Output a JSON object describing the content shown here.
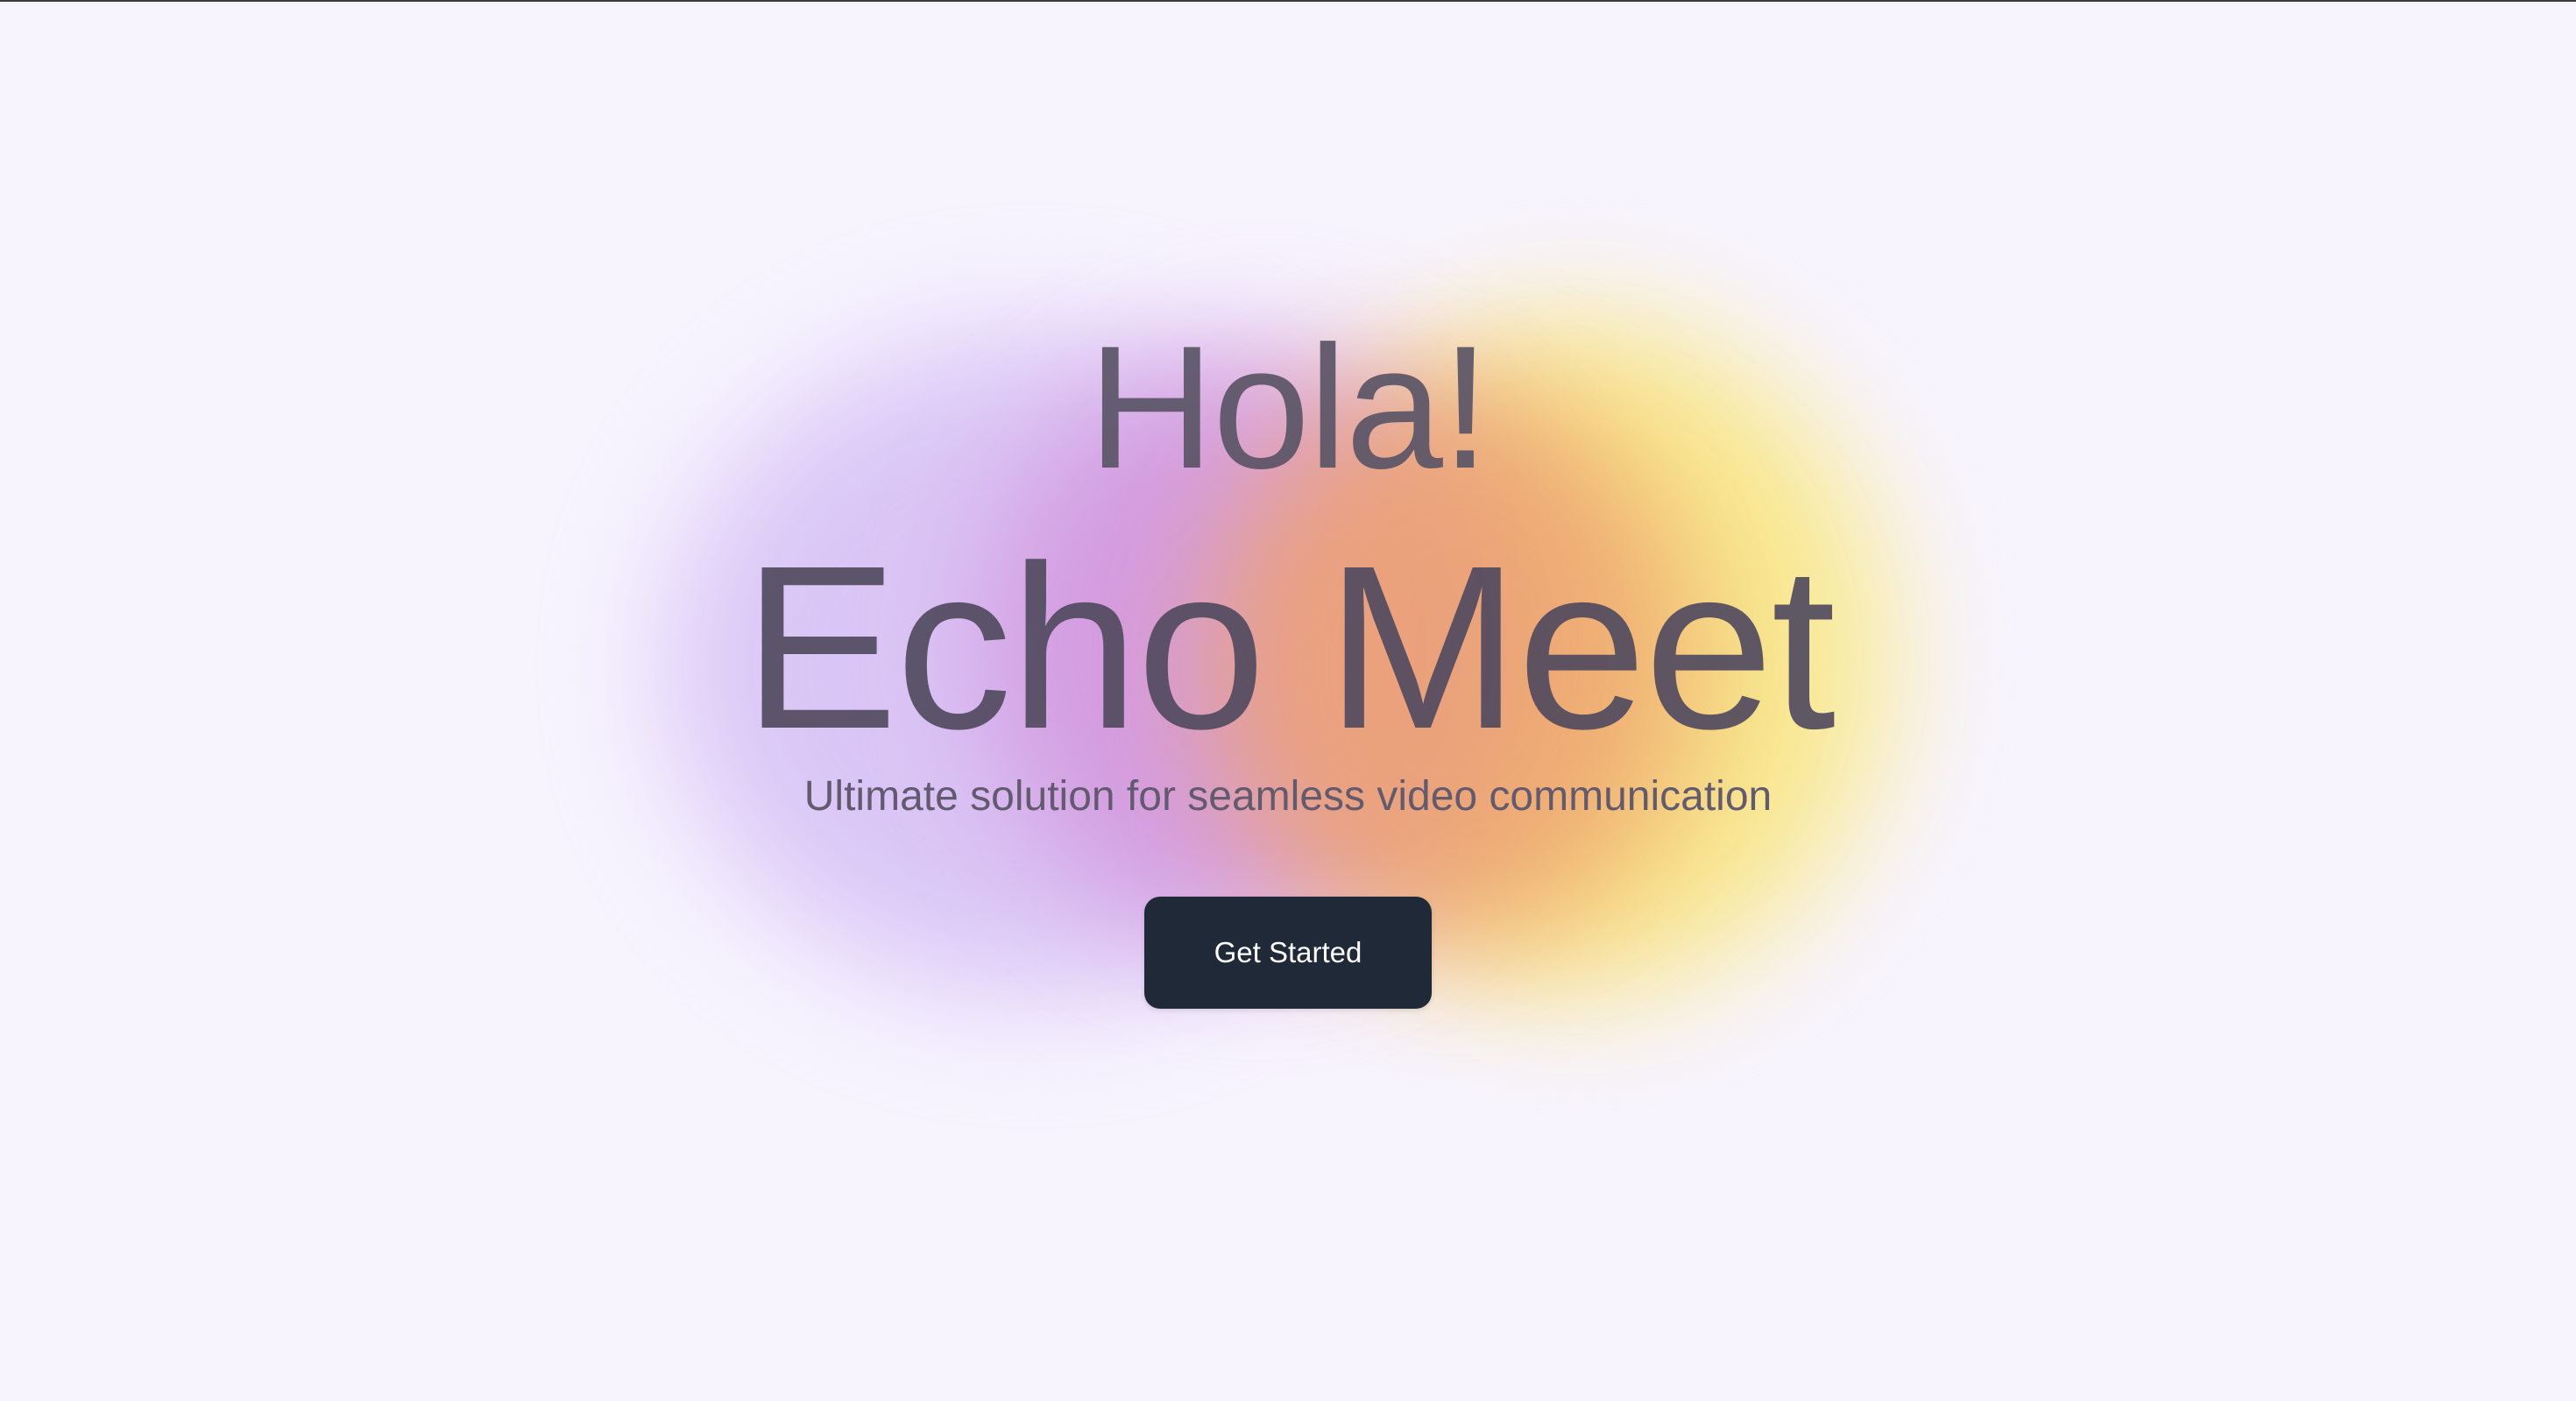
{
  "hero": {
    "greeting": "Hola!",
    "title": "Echo Meet",
    "subtitle": "Ultimate solution for seamless video communication",
    "cta_label": "Get Started"
  },
  "colors": {
    "background": "#f7f4fe",
    "button": "#1f2937",
    "button_text": "#ffffff",
    "blob_purple": "#d9c4f6",
    "blob_magenta": "#d28ed8",
    "blob_orange": "#eea16a",
    "blob_yellow": "#f9e98a"
  }
}
